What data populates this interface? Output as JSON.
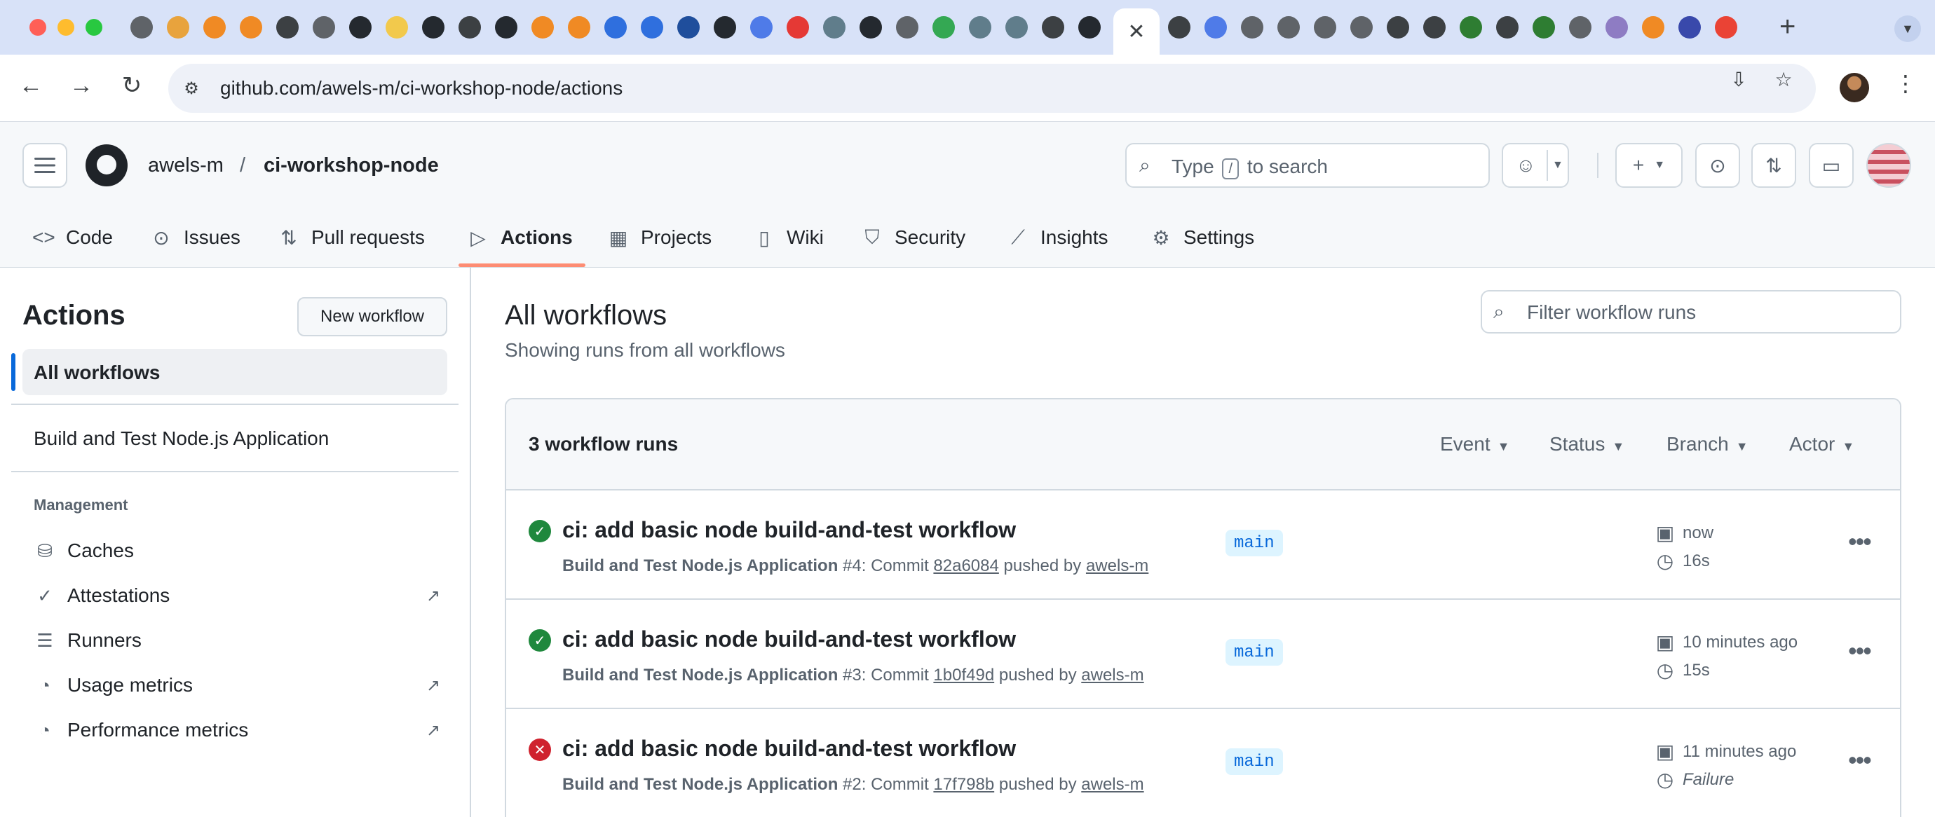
{
  "browser": {
    "url": "github.com/awels-m/ci-workshop-node/actions",
    "active_tab_close": "✕",
    "new_tab": "+",
    "tab_list_icon": "chevron-down-icon"
  },
  "header": {
    "owner": "awels-m",
    "separator": "/",
    "repo": "ci-workshop-node",
    "search_prefix": "Type",
    "search_key": "/",
    "search_suffix": "to search"
  },
  "repo_tabs": [
    {
      "label": "Code",
      "icon": "code-icon"
    },
    {
      "label": "Issues",
      "icon": "issue-icon"
    },
    {
      "label": "Pull requests",
      "icon": "pull-request-icon"
    },
    {
      "label": "Actions",
      "icon": "play-icon"
    },
    {
      "label": "Projects",
      "icon": "table-icon"
    },
    {
      "label": "Wiki",
      "icon": "book-icon"
    },
    {
      "label": "Security",
      "icon": "shield-icon"
    },
    {
      "label": "Insights",
      "icon": "graph-icon"
    },
    {
      "label": "Settings",
      "icon": "gear-icon"
    }
  ],
  "sidebar": {
    "title": "Actions",
    "new_workflow": "New workflow",
    "active": "All workflows",
    "workflows": [
      "Build and Test Node.js Application"
    ],
    "section": "Management",
    "items": [
      {
        "label": "Caches",
        "icon": "database-icon",
        "external": false
      },
      {
        "label": "Attestations",
        "icon": "verified-icon",
        "external": true
      },
      {
        "label": "Runners",
        "icon": "server-icon",
        "external": false
      },
      {
        "label": "Usage metrics",
        "icon": "meter-icon",
        "external": true
      },
      {
        "label": "Performance metrics",
        "icon": "meter-icon",
        "external": true
      }
    ]
  },
  "main": {
    "title": "All workflows",
    "subtitle": "Showing runs from all workflows",
    "filter_placeholder": "Filter workflow runs",
    "count": "3 workflow runs",
    "filters": [
      "Event",
      "Status",
      "Branch",
      "Actor"
    ],
    "runs": [
      {
        "status": "success",
        "title": "ci: add basic node build-and-test workflow",
        "workflow": "Build and Test Node.js Application",
        "number": "#4",
        "commit_prefix": ": Commit",
        "sha": "82a6084",
        "pushed_by": "pushed by",
        "actor": "awels-m",
        "branch": "main",
        "when": "now",
        "duration": "16s"
      },
      {
        "status": "success",
        "title": "ci: add basic node build-and-test workflow",
        "workflow": "Build and Test Node.js Application",
        "number": "#3",
        "commit_prefix": ": Commit",
        "sha": "1b0f49d",
        "pushed_by": "pushed by",
        "actor": "awels-m",
        "branch": "main",
        "when": "10 minutes ago",
        "duration": "15s"
      },
      {
        "status": "failure",
        "title": "ci: add basic node build-and-test workflow",
        "workflow": "Build and Test Node.js Application",
        "number": "#2",
        "commit_prefix": ": Commit",
        "sha": "17f798b",
        "pushed_by": "pushed by",
        "actor": "awels-m",
        "branch": "main",
        "when": "11 minutes ago",
        "duration": "Failure"
      }
    ]
  },
  "colors": {
    "success": "#1f883d",
    "failure": "#cf222e",
    "accent": "#0969da",
    "active_tab_underline": "#fd8c73"
  }
}
